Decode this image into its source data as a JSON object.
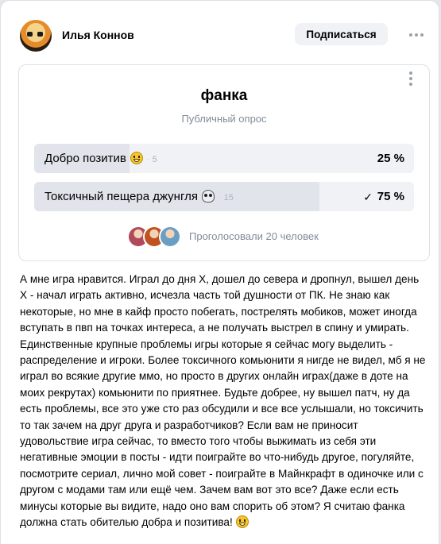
{
  "post": {
    "author": "Илья Коннов",
    "subscribe_label": "Подписаться",
    "text": "А мне игра нравится. Играл до дня Х, дошел до севера и дропнул, вышел день Х - начал играть активно, исчезла часть той душности от ПК. Не знаю как некоторые, но мне в кайф просто побегать, пострелять мобиков, может иногда вступать в пвп на точках интереса, а не получать выстрел в спину и умирать. Единственные крупные проблемы игры которые я сейчас могу выделить - распределение и игроки. Более токсичного комьюнити я нигде не видел, мб я не играл во всякие другие ммо, но просто в других онлайн играх(даже в доте на моих рекрутах) комьюнити по приятнее. Будьте добрее, ну вышел патч, ну да есть проблемы, все это уже сто раз обсудили и все все услышали, но токсичить то так зачем на друг друга и разработчиков? Если вам не приносит удовольствие игра сейчас, то вместо того чтобы выжимать из себя эти негативные эмоции в посты - идти поиграйте во что-нибудь другое, погуляйте, посмотрите сериал, лично мой совет - поиграйте в Майнкрафт в одиночке или с другом с модами там или ещё чем. Зачем вам вот это все? Даже если есть минусы которые вы видите, надо оно вам спорить об этом? Я считаю фанка должна стать обителью добра и позитива!",
    "trailing_emoji": "grinning-face"
  },
  "poll": {
    "title": "фанка",
    "subtitle": "Публичный опрос",
    "options": [
      {
        "label": "Добро позитив",
        "emoji": "grinning-face",
        "dot": "·",
        "count": "5",
        "percent_label": "25 %",
        "percent": 25,
        "voted": false
      },
      {
        "label": "Токсичный пещера джунгля",
        "emoji": "skull",
        "dot": "·",
        "count": "15",
        "percent_label": "75 %",
        "percent": 75,
        "voted": true,
        "check": "✓"
      }
    ],
    "voters_text": "Проголосовали 20 человек",
    "voter_avatar_colors": [
      "#b04a5a",
      "#c0521f",
      "#6a9fc4"
    ]
  },
  "colors": {
    "accent_gray": "#818c99",
    "option_bg": "#f0f2f5",
    "option_fill": "#e1e5eb"
  }
}
